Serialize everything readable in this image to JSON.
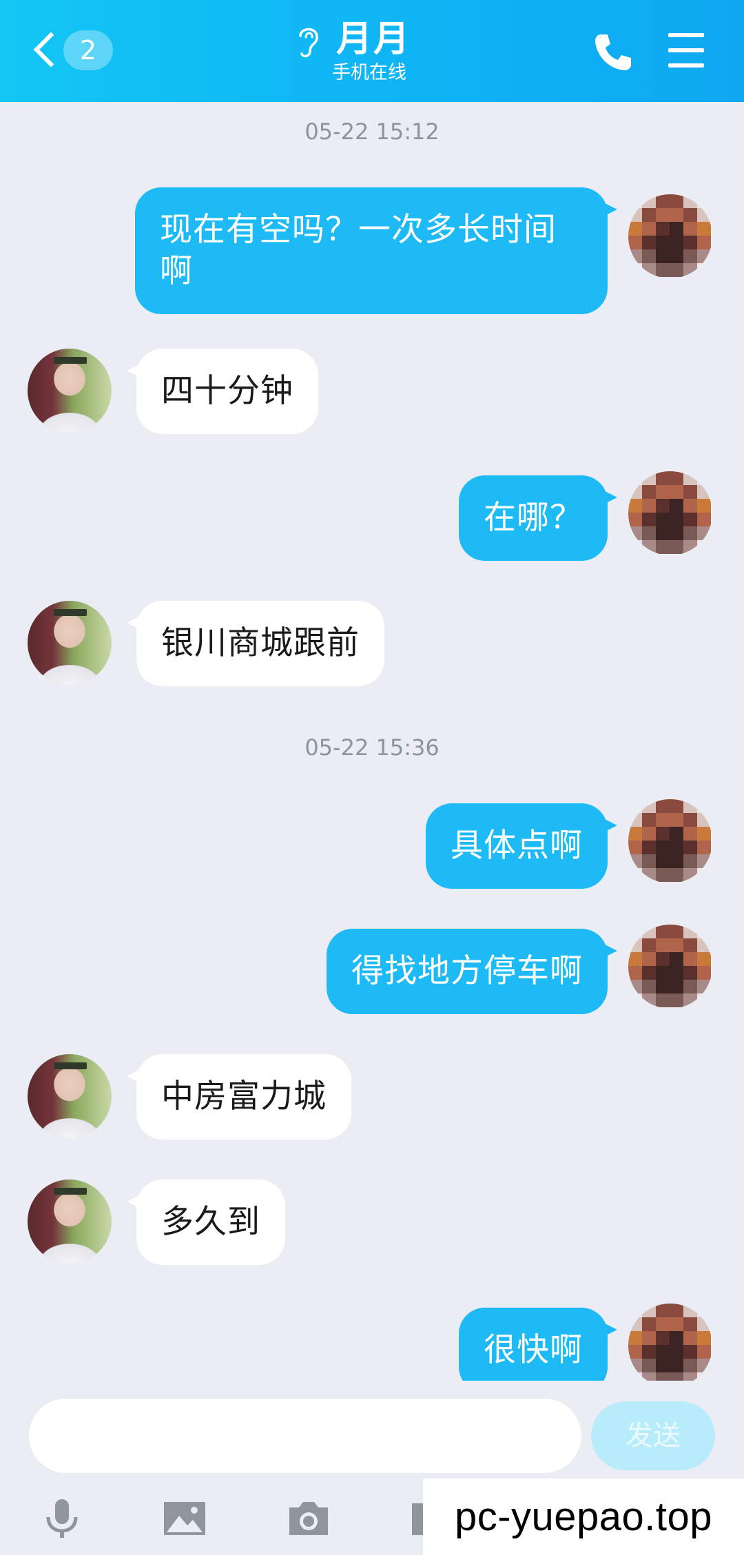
{
  "header": {
    "unread_count": "2",
    "contact_name": "月月",
    "contact_status": "手机在线"
  },
  "messages": [
    {
      "type": "timestamp",
      "text": "05-22 15:12"
    },
    {
      "type": "sent",
      "text": "现在有空吗？一次多长时间啊"
    },
    {
      "type": "received",
      "text": "四十分钟"
    },
    {
      "type": "sent",
      "text": "在哪？"
    },
    {
      "type": "received",
      "text": "银川商城跟前"
    },
    {
      "type": "timestamp",
      "text": "05-22 15:36"
    },
    {
      "type": "sent",
      "text": "具体点啊"
    },
    {
      "type": "sent",
      "text": "得找地方停车啊"
    },
    {
      "type": "received",
      "text": "中房富力城"
    },
    {
      "type": "received",
      "text": "多久到"
    },
    {
      "type": "sent",
      "text": "很快啊"
    }
  ],
  "input": {
    "value": "",
    "send_label": "发送"
  },
  "toolbar": {
    "icons": [
      "microphone-icon",
      "image-icon",
      "camera-icon"
    ]
  },
  "watermark": "pc-yuepao.top",
  "colors": {
    "header_gradient_start": "#13c6f4",
    "header_gradient_end": "#0ea8f2",
    "sent_bubble": "#1dbaf6",
    "received_bubble": "#ffffff",
    "background": "#ebedf5",
    "send_button": "#b9ecfb"
  }
}
